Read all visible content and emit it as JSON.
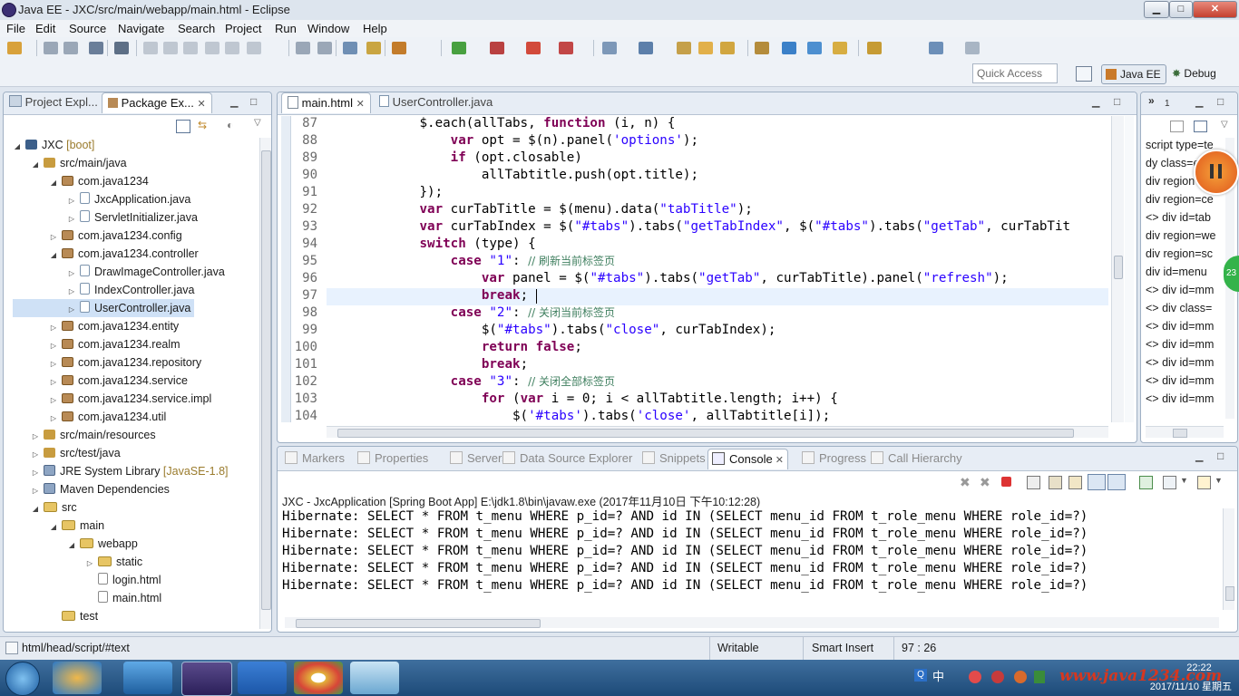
{
  "window": {
    "title": "Java EE - JXC/src/main/webapp/main.html - Eclipse",
    "min": "▁",
    "max": "□",
    "close": "✕"
  },
  "menubar": [
    "File",
    "Edit",
    "Source",
    "Navigate",
    "Search",
    "Project",
    "Run",
    "Window",
    "Help"
  ],
  "toolbar": {
    "quick_access_placeholder": "Quick Access",
    "perspective_active": "Java EE",
    "perspective_other": "Debug"
  },
  "left_panel": {
    "tabs": [
      {
        "label": "Project Expl..."
      },
      {
        "label": "Package Ex..."
      }
    ],
    "tree": [
      {
        "label": "JXC",
        "decor": "[boot]",
        "icon": "project",
        "expanded": true
      },
      {
        "label": "src/main/java",
        "icon": "source-folder",
        "expanded": true
      },
      {
        "label": "com.java1234",
        "icon": "package",
        "expanded": true
      },
      {
        "label": "JxcApplication.java",
        "icon": "java-file",
        "expanded": false
      },
      {
        "label": "ServletInitializer.java",
        "icon": "java-file",
        "expanded": false
      },
      {
        "label": "com.java1234.config",
        "icon": "package",
        "expanded": false
      },
      {
        "label": "com.java1234.controller",
        "icon": "package",
        "expanded": true
      },
      {
        "label": "DrawImageController.java",
        "icon": "java-file",
        "expanded": false
      },
      {
        "label": "IndexController.java",
        "icon": "java-file",
        "expanded": false
      },
      {
        "label": "UserController.java",
        "icon": "java-file",
        "expanded": false,
        "selected": true
      },
      {
        "label": "com.java1234.entity",
        "icon": "package",
        "expanded": false
      },
      {
        "label": "com.java1234.realm",
        "icon": "package",
        "expanded": false
      },
      {
        "label": "com.java1234.repository",
        "icon": "package",
        "expanded": false
      },
      {
        "label": "com.java1234.service",
        "icon": "package",
        "expanded": false
      },
      {
        "label": "com.java1234.service.impl",
        "icon": "package",
        "expanded": false
      },
      {
        "label": "com.java1234.util",
        "icon": "package",
        "expanded": false
      },
      {
        "label": "src/main/resources",
        "icon": "source-folder",
        "expanded": false
      },
      {
        "label": "src/test/java",
        "icon": "source-folder",
        "expanded": false
      },
      {
        "label": "JRE System Library",
        "decor": "[JavaSE-1.8]",
        "icon": "library",
        "expanded": false
      },
      {
        "label": "Maven Dependencies",
        "icon": "library",
        "expanded": false
      },
      {
        "label": "src",
        "icon": "folder",
        "expanded": true
      },
      {
        "label": "main",
        "icon": "folder",
        "expanded": true
      },
      {
        "label": "webapp",
        "icon": "folder",
        "expanded": true
      },
      {
        "label": "static",
        "icon": "folder",
        "expanded": false
      },
      {
        "label": "login.html",
        "icon": "file",
        "expanded": null
      },
      {
        "label": "main.html",
        "icon": "file",
        "expanded": null
      },
      {
        "label": "test",
        "icon": "folder",
        "expanded": null
      }
    ]
  },
  "editor": {
    "tabs": [
      {
        "label": "main.html",
        "active": true
      },
      {
        "label": "UserController.java",
        "active": false
      }
    ],
    "lines": [
      {
        "n": "87",
        "segs": [
          [
            "",
            "            $.each(allTabs, "
          ],
          [
            "kw",
            "function"
          ],
          [
            "",
            " (i, n) {"
          ]
        ]
      },
      {
        "n": "88",
        "segs": [
          [
            "",
            "                "
          ],
          [
            "kw",
            "var"
          ],
          [
            "",
            " opt = $(n).panel("
          ],
          [
            "str",
            "'options'"
          ],
          [
            "",
            ");"
          ]
        ]
      },
      {
        "n": "89",
        "segs": [
          [
            "",
            "                "
          ],
          [
            "kw",
            "if"
          ],
          [
            "",
            " (opt.closable)"
          ]
        ]
      },
      {
        "n": "90",
        "segs": [
          [
            "",
            "                    allTabtitle.push(opt.title);"
          ]
        ]
      },
      {
        "n": "91",
        "segs": [
          [
            "",
            "            });"
          ]
        ]
      },
      {
        "n": "92",
        "segs": [
          [
            "",
            "            "
          ],
          [
            "kw",
            "var"
          ],
          [
            "",
            " curTabTitle = $(menu).data("
          ],
          [
            "str",
            "\"tabTitle\""
          ],
          [
            "",
            ");"
          ]
        ]
      },
      {
        "n": "93",
        "segs": [
          [
            "",
            "            "
          ],
          [
            "kw",
            "var"
          ],
          [
            "",
            " curTabIndex = $("
          ],
          [
            "str",
            "\"#tabs\""
          ],
          [
            "",
            ").tabs("
          ],
          [
            "str",
            "\"getTabIndex\""
          ],
          [
            "",
            ", $("
          ],
          [
            "str",
            "\"#tabs\""
          ],
          [
            "",
            ").tabs("
          ],
          [
            "str",
            "\"getTab\""
          ],
          [
            "",
            ", curTabTit"
          ]
        ]
      },
      {
        "n": "94",
        "segs": [
          [
            "",
            "            "
          ],
          [
            "kw",
            "switch"
          ],
          [
            "",
            " (type) {"
          ]
        ]
      },
      {
        "n": "95",
        "segs": [
          [
            "",
            "                "
          ],
          [
            "kw",
            "case"
          ],
          [
            "",
            " "
          ],
          [
            "str",
            "\"1\""
          ],
          [
            "",
            ": "
          ],
          [
            "cm",
            "// 刷新当前标签页"
          ]
        ]
      },
      {
        "n": "96",
        "segs": [
          [
            "",
            "                    "
          ],
          [
            "kw",
            "var"
          ],
          [
            "",
            " panel = $("
          ],
          [
            "str",
            "\"#tabs\""
          ],
          [
            "",
            ").tabs("
          ],
          [
            "str",
            "\"getTab\""
          ],
          [
            "",
            ", curTabTitle).panel("
          ],
          [
            "str",
            "\"refresh\""
          ],
          [
            "",
            ");"
          ]
        ]
      },
      {
        "n": "97",
        "segs": [
          [
            "",
            "                    "
          ],
          [
            "kw",
            "break"
          ],
          [
            "",
            ";"
          ]
        ]
      },
      {
        "n": "98",
        "segs": [
          [
            "",
            "                "
          ],
          [
            "kw",
            "case"
          ],
          [
            "",
            " "
          ],
          [
            "str",
            "\"2\""
          ],
          [
            "",
            ": "
          ],
          [
            "cm",
            "// 关闭当前标签页"
          ]
        ]
      },
      {
        "n": "99",
        "segs": [
          [
            "",
            "                    $("
          ],
          [
            "str",
            "\"#tabs\""
          ],
          [
            "",
            ").tabs("
          ],
          [
            "str",
            "\"close\""
          ],
          [
            "",
            ", curTabIndex);"
          ]
        ]
      },
      {
        "n": "100",
        "segs": [
          [
            "",
            "                    "
          ],
          [
            "kw",
            "return false"
          ],
          [
            "",
            ";"
          ]
        ]
      },
      {
        "n": "101",
        "segs": [
          [
            "",
            "                    "
          ],
          [
            "kw",
            "break"
          ],
          [
            "",
            ";"
          ]
        ]
      },
      {
        "n": "102",
        "segs": [
          [
            "",
            "                "
          ],
          [
            "kw",
            "case"
          ],
          [
            "",
            " "
          ],
          [
            "str",
            "\"3\""
          ],
          [
            "",
            ": "
          ],
          [
            "cm",
            "// 关闭全部标签页"
          ]
        ]
      },
      {
        "n": "103",
        "segs": [
          [
            "",
            "                    "
          ],
          [
            "kw",
            "for"
          ],
          [
            "",
            " ("
          ],
          [
            "kw",
            "var"
          ],
          [
            "",
            " i = 0; i < allTabtitle.length; i++) {"
          ]
        ]
      },
      {
        "n": "104",
        "segs": [
          [
            "",
            "                        $("
          ],
          [
            "str",
            "'#tabs'"
          ],
          [
            "",
            ").tabs("
          ],
          [
            "str",
            "'close'"
          ],
          [
            "",
            ", allTabtitle[i]);"
          ]
        ]
      }
    ]
  },
  "outline": {
    "tab_label": "1",
    "items": [
      "script type=te",
      "dy class=e",
      "div region",
      "div region=ce",
      "<> div id=tab",
      "div region=we",
      "div region=sc",
      "div id=menu",
      "<> div id=mm",
      "<> div class=",
      "<> div id=mm",
      "<> div id=mm",
      "<> div id=mm",
      "<> div id=mm",
      "<> div id=mm"
    ],
    "badge": "23"
  },
  "bottom_panel": {
    "tabs": [
      {
        "label": "Markers",
        "active": false
      },
      {
        "label": "Properties",
        "active": false
      },
      {
        "label": "Servers",
        "active": false
      },
      {
        "label": "Data Source Explorer",
        "active": false
      },
      {
        "label": "Snippets",
        "active": false
      },
      {
        "label": "Console",
        "active": true
      },
      {
        "label": "Progress",
        "active": false
      },
      {
        "label": "Call Hierarchy",
        "active": false
      }
    ],
    "process": "JXC - JxcApplication [Spring Boot App] E:\\jdk1.8\\bin\\javaw.exe (2017年11月10日 下午10:12:28)",
    "lines": [
      "Hibernate: SELECT * FROM t_menu WHERE p_id=? AND id IN (SELECT menu_id FROM t_role_menu WHERE role_id=?)",
      "Hibernate: SELECT * FROM t_menu WHERE p_id=? AND id IN (SELECT menu_id FROM t_role_menu WHERE role_id=?)",
      "Hibernate: SELECT * FROM t_menu WHERE p_id=? AND id IN (SELECT menu_id FROM t_role_menu WHERE role_id=?)",
      "Hibernate: SELECT * FROM t_menu WHERE p_id=? AND id IN (SELECT menu_id FROM t_role_menu WHERE role_id=?)",
      "Hibernate: SELECT * FROM t_menu WHERE p_id=? AND id IN (SELECT menu_id FROM t_role_menu WHERE role_id=?)"
    ]
  },
  "statusbar": {
    "path": "html/head/script/#text",
    "mode": "Writable",
    "insert": "Smart Insert",
    "position": "97 : 26"
  },
  "taskbar": {
    "time": "22:22",
    "date": "2017/11/10 星期五",
    "watermark": "www.java1234.com",
    "ime": "中"
  },
  "colors": {
    "accent": "#2b5f96",
    "keyword": "#7f0055",
    "string": "#2a00ff",
    "comment": "#3f7f5f"
  }
}
